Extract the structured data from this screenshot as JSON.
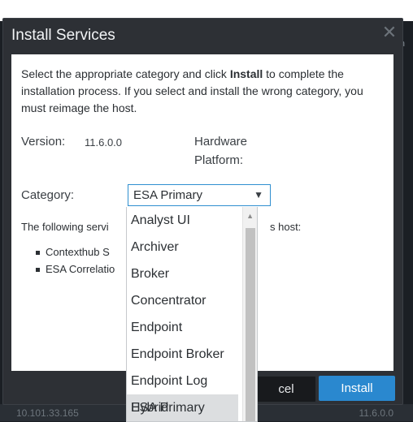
{
  "dialog": {
    "title": "Install Services",
    "close_glyph": "✕",
    "intro_pre": "Select the appropriate category and click ",
    "intro_bold": "Install",
    "intro_post": " to complete the installation process. If you select and install the wrong category, you must reimage the host.",
    "version_label": "Version:",
    "version_value": "11.6.0.0",
    "hardware_label_1": "Hardware",
    "hardware_label_2": "Platform:",
    "category_label": "Category:",
    "category_selected": "ESA Primary",
    "services_pre": "The following servi",
    "services_post": "s host:",
    "services": [
      "Contexthub S",
      "ESA Correlatio"
    ],
    "cancel_label": "cel",
    "install_label": "Install"
  },
  "dropdown": {
    "options": [
      "Analyst UI",
      "Archiver",
      "Broker",
      "Concentrator",
      "Endpoint",
      "Endpoint Broker",
      "Endpoint Log Hybrid",
      "ESA Primary"
    ],
    "selected": "ESA Primary"
  },
  "background": {
    "corner_label": "on",
    "bottom_left": "10.101.33.165",
    "bottom_right": "11.6.0.0"
  },
  "colors": {
    "accent": "#2a88cf",
    "dialog_bg": "#2d3035",
    "select_border": "#2f8fd0"
  }
}
